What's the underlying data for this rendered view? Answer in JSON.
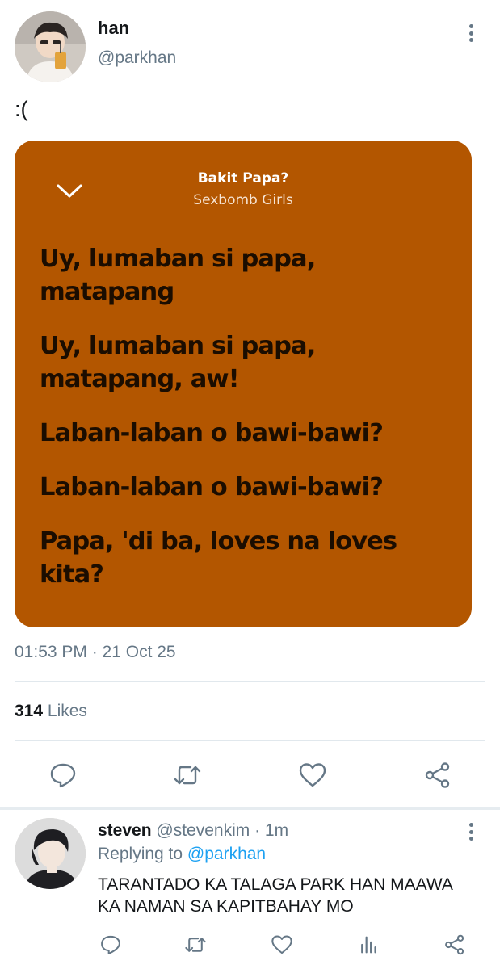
{
  "tweet": {
    "author_name": "han",
    "author_handle": "@parkhan",
    "text": ":(",
    "timestamp": "01:53 PM · 21 Oct 25",
    "likes_count": "314",
    "likes_label": "Likes",
    "actions": [
      "reply-icon",
      "retweet-icon",
      "like-icon",
      "share-icon"
    ]
  },
  "lyrics_card": {
    "background_color": "#b35600",
    "song_title": "Bakit Papa?",
    "artist": "Sexbomb Girls",
    "lines": [
      "Uy, lumaban si papa, matapang",
      "Uy, lumaban si papa, matapang, aw!",
      "Laban-laban o bawi-bawi?",
      "Laban-laban o bawi-bawi?",
      "Papa, 'di ba, loves na loves kita?"
    ]
  },
  "reply": {
    "author_name": "steven",
    "author_handle": "@stevenkim",
    "time_ago": "· 1m",
    "replying_prefix": "Replying to",
    "replying_handle": "@parkhan",
    "text": "TARANTADO KA TALAGA PARK HAN MAAWA KA NAMAN SA KAPITBAHAY MO",
    "actions": [
      "reply-icon",
      "retweet-icon",
      "like-icon",
      "analytics-icon",
      "share-icon"
    ]
  },
  "colors": {
    "secondary_text": "#657786",
    "link": "#1da1f2",
    "divider": "#e1e8ed"
  }
}
